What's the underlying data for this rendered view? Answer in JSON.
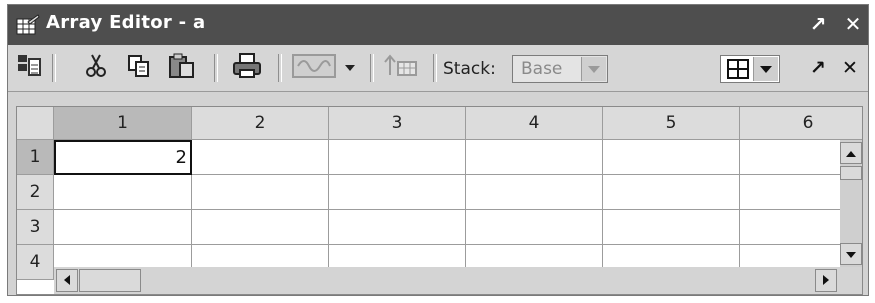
{
  "window": {
    "title": "Array Editor - a",
    "undock_glyph": "↗",
    "close_glyph": "✕"
  },
  "toolbar": {
    "stack_label": "Stack:",
    "stack_value": "Base",
    "undock_glyph": "↗",
    "close_glyph": "✕"
  },
  "grid": {
    "columns": [
      "1",
      "2",
      "3",
      "4",
      "5",
      "6"
    ],
    "rows": [
      "1",
      "2",
      "3",
      "4"
    ],
    "cells": [
      [
        "2",
        "",
        "",
        "",
        "",
        ""
      ],
      [
        "",
        "",
        "",
        "",
        "",
        ""
      ],
      [
        "",
        "",
        "",
        "",
        "",
        ""
      ],
      [
        "",
        "",
        "",
        "",
        "",
        ""
      ]
    ]
  },
  "icons": {
    "window": "array-editor-window-icon",
    "import": "import-data-icon",
    "cut": "cut-icon",
    "copy": "copy-icon",
    "paste": "paste-icon",
    "print": "print-icon",
    "plot": "plot-selection-icon",
    "plot_menu": "chevron-down-icon",
    "stack_up": "stack-up-icon",
    "grid_layout": "grid-layout-icon"
  }
}
